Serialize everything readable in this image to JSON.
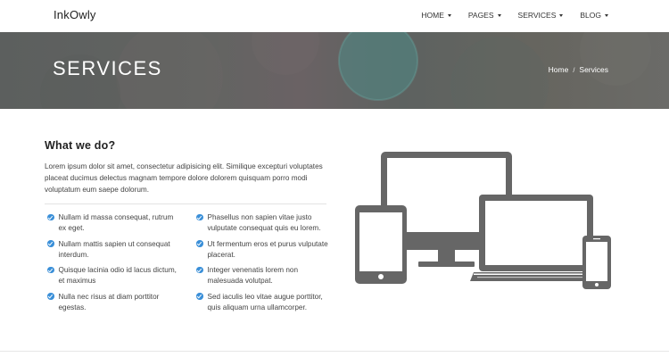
{
  "header": {
    "brand": "InkOwly",
    "nav": [
      {
        "label": "HOME"
      },
      {
        "label": "PAGES"
      },
      {
        "label": "SERVICES"
      },
      {
        "label": "BLOG"
      }
    ]
  },
  "hero": {
    "title": "SERVICES",
    "breadcrumb": {
      "home": "Home",
      "separator": "/",
      "current": "Services"
    }
  },
  "content": {
    "heading": "What we do?",
    "intro": "Lorem ipsum dolor sit amet, consectetur adipisicing elit. Similique excepturi voluptates placeat ducimus delectus magnam tempore dolore dolorem quisquam porro modi voluptatum eum saepe dolorum.",
    "features_left": [
      "Nullam id massa consequat, rutrum ex eget.",
      "Nullam mattis sapien ut consequat interdum.",
      "Quisque lacinia odio id lacus dictum, et maximus",
      "Nulla nec risus at diam porttitor egestas."
    ],
    "features_right": [
      "Phasellus non sapien vitae justo vulputate consequat quis eu lorem.",
      "Ut fermentum eros et purus vulputate placerat.",
      "Integer venenatis lorem non malesuada volutpat.",
      "Sed iaculis leo vitae augue porttitor, quis aliquam urna ullamcorper."
    ],
    "illustration_icon": "responsive-devices-icon"
  },
  "colors": {
    "accent": "#3a8fd8",
    "device_gray": "#666666",
    "hero_overlay": "#5f6261"
  }
}
